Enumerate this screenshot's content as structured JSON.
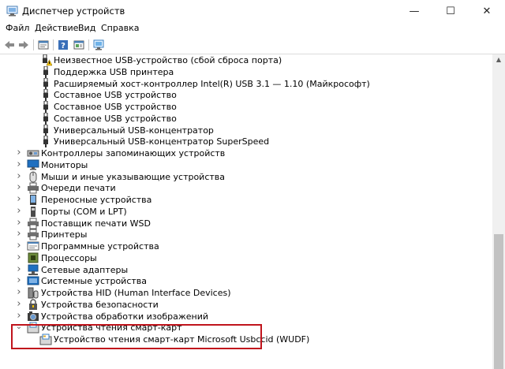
{
  "window": {
    "title": "Диспетчер устройств",
    "minimize_glyph": "—",
    "maximize_glyph": "☐",
    "close_glyph": "✕"
  },
  "menu": [
    {
      "label": "Файл"
    },
    {
      "label": "Действие"
    },
    {
      "label": "Вид"
    },
    {
      "label": "Справка"
    }
  ],
  "toolbar": [
    {
      "icon": "back-arrow-icon"
    },
    {
      "icon": "forward-arrow-icon"
    },
    {
      "icon": "properties-icon"
    },
    {
      "icon": "help-icon"
    },
    {
      "icon": "update-driver-icon"
    },
    {
      "icon": "scan-monitor-icon"
    }
  ],
  "tree": {
    "rows": [
      {
        "label": "Неизвестное USB-устройство (сбой сброса порта)",
        "icon": "usb-warning-icon",
        "level": 2
      },
      {
        "label": "Поддержка USB принтера",
        "icon": "usb-icon",
        "level": 2
      },
      {
        "label": "Расширяемый хост-контроллер Intel(R) USB 3.1 — 1.10 (Майкрософт)",
        "icon": "usb-icon",
        "level": 2
      },
      {
        "label": "Составное USB устройство",
        "icon": "usb-icon",
        "level": 2
      },
      {
        "label": "Составное USB устройство",
        "icon": "usb-icon",
        "level": 2
      },
      {
        "label": "Составное USB устройство",
        "icon": "usb-icon",
        "level": 2
      },
      {
        "label": "Универсальный USB-концентратор",
        "icon": "usb-icon",
        "level": 2
      },
      {
        "label": "Универсальный USB-концентратор SuperSpeed",
        "icon": "usb-icon",
        "level": 2
      },
      {
        "label": "Контроллеры запоминающих устройств",
        "icon": "storage-controller-icon",
        "level": 1,
        "expander": "collapsed"
      },
      {
        "label": "Мониторы",
        "icon": "monitor-icon",
        "level": 1,
        "expander": "collapsed"
      },
      {
        "label": "Мыши и иные указывающие устройства",
        "icon": "mouse-icon",
        "level": 1,
        "expander": "collapsed"
      },
      {
        "label": "Очереди печати",
        "icon": "print-queue-icon",
        "level": 1,
        "expander": "collapsed"
      },
      {
        "label": "Переносные устройства",
        "icon": "portable-device-icon",
        "level": 1,
        "expander": "collapsed"
      },
      {
        "label": "Порты (COM и LPT)",
        "icon": "port-icon",
        "level": 1,
        "expander": "collapsed"
      },
      {
        "label": "Поставщик печати WSD",
        "icon": "printer-icon",
        "level": 1,
        "expander": "collapsed"
      },
      {
        "label": "Принтеры",
        "icon": "printer-icon",
        "level": 1,
        "expander": "collapsed"
      },
      {
        "label": "Программные устройства",
        "icon": "software-device-icon",
        "level": 1,
        "expander": "collapsed"
      },
      {
        "label": "Процессоры",
        "icon": "processor-icon",
        "level": 1,
        "expander": "collapsed"
      },
      {
        "label": "Сетевые адаптеры",
        "icon": "network-adapter-icon",
        "level": 1,
        "expander": "collapsed"
      },
      {
        "label": "Системные устройства",
        "icon": "system-device-icon",
        "level": 1,
        "expander": "collapsed"
      },
      {
        "label": "Устройства HID (Human Interface Devices)",
        "icon": "hid-icon",
        "level": 1,
        "expander": "collapsed"
      },
      {
        "label": "Устройства безопасности",
        "icon": "security-device-icon",
        "level": 1,
        "expander": "collapsed"
      },
      {
        "label": "Устройства обработки изображений",
        "icon": "imaging-device-icon",
        "level": 1,
        "expander": "collapsed"
      },
      {
        "label": "Устройства чтения смарт-карт",
        "icon": "smartcard-reader-icon",
        "level": 1,
        "expander": "expanded"
      },
      {
        "label": "Устройство чтения смарт-карт Microsoft Usbccid (WUDF)",
        "icon": "smartcard-reader-icon",
        "level": 2
      }
    ]
  },
  "colors": {
    "highlight_border": "#c0141c",
    "usb_icon": "#333333",
    "warning": "#f2c200"
  }
}
